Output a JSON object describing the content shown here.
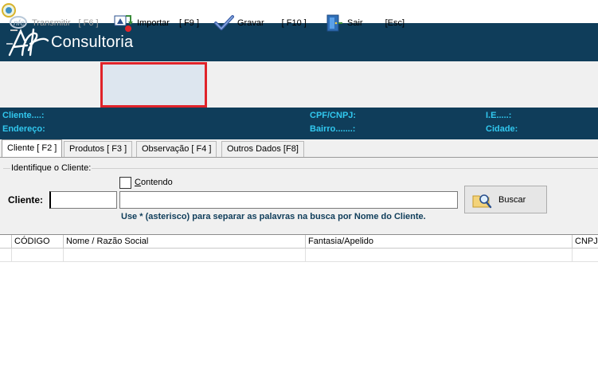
{
  "banner": {
    "brand": "Consultoria"
  },
  "toolbar": {
    "transmitir": {
      "label": "Transmitir",
      "key": "[ F6 ]"
    },
    "importar": {
      "label": "Importar",
      "key": "[ F9 ]"
    },
    "gravar": {
      "label": "Gravar",
      "key": "[ F10 ]"
    },
    "sair": {
      "label": "Sair",
      "key": "[Esc]"
    }
  },
  "info": {
    "cliente": "Cliente....:",
    "endereco": "Endereço:",
    "cpf": "CPF/CNPJ:",
    "bairro": "Bairro.......:",
    "ie": "I.E.....:",
    "cidade": "Cidade:"
  },
  "tabs": [
    {
      "label": "Cliente [ F2 ]",
      "active": true
    },
    {
      "label": "Produtos [ F3 ]"
    },
    {
      "label": "Observação [ F4 ]"
    },
    {
      "label": "Outros Dados [F8]"
    }
  ],
  "search": {
    "group_title": "Identifique o Cliente:",
    "contendo_label": "Contendo",
    "cliente_label": "Cliente:",
    "code_value": "",
    "name_value": "",
    "buscar_label": "Buscar",
    "hint": "Use * (asterisco) para separar as palavras na busca por Nome do Cliente."
  },
  "grid": {
    "columns": [
      "CÓDIGO",
      "Nome / Razão Social",
      "Fantasia/Apelido",
      "CNPJ"
    ],
    "rows": []
  },
  "colors": {
    "navy": "#0f3d5a",
    "cyan_text": "#31c8ef",
    "highlight": "#e0232a"
  },
  "icons": {
    "app": "app-globe-icon",
    "logo": "afk-logo-icon",
    "transmitir": "transmit-icon",
    "importar": "import-icon",
    "gravar": "checkmark-icon",
    "sair": "door-exit-icon",
    "buscar": "search-folder-icon"
  }
}
